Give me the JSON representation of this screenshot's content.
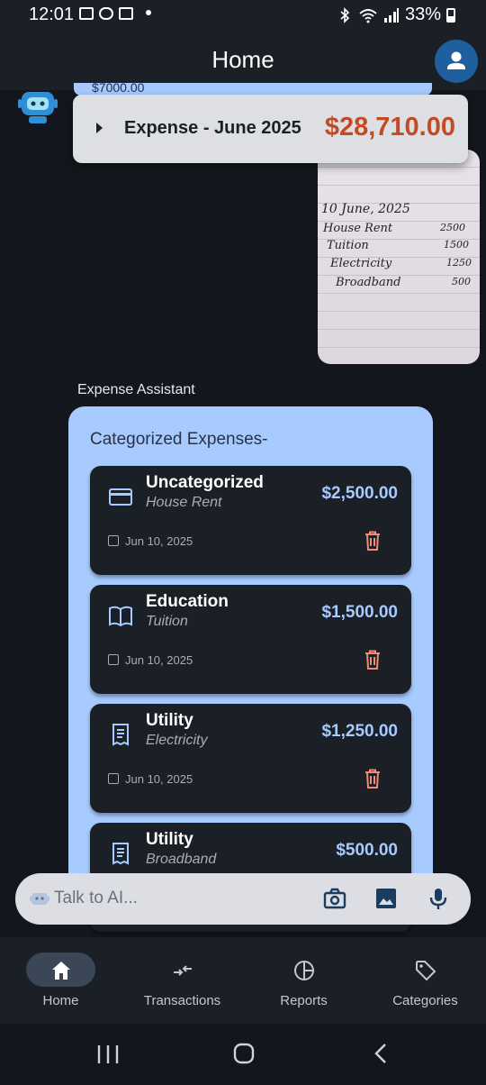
{
  "status_bar": {
    "time": "12:01",
    "battery": "33%"
  },
  "header": {
    "title": "Home"
  },
  "chat": {
    "prev_message_fragment": "$7000.00",
    "expense_banner": {
      "label": "Expense - June 2025",
      "amount": "$28,710.00"
    },
    "receipt_photo": {
      "date_line": "10 June, 2025",
      "lines": [
        {
          "item": "House Rent",
          "value": "2500"
        },
        {
          "item": "Tuition",
          "value": "1500"
        },
        {
          "item": "Electricity",
          "value": "1250"
        },
        {
          "item": "Broadband",
          "value": "500"
        }
      ]
    },
    "assistant_label": "Expense Assistant",
    "panel_heading": "Categorized Expenses-",
    "expenses": [
      {
        "category": "Uncategorized",
        "description": "House Rent",
        "amount": "$2,500.00",
        "date": "Jun 10, 2025",
        "icon": "credit-card-icon"
      },
      {
        "category": "Education",
        "description": "Tuition",
        "amount": "$1,500.00",
        "date": "Jun 10, 2025",
        "icon": "book-icon"
      },
      {
        "category": "Utility",
        "description": "Electricity",
        "amount": "$1,250.00",
        "date": "Jun 10, 2025",
        "icon": "receipt-icon"
      },
      {
        "category": "Utility",
        "description": "Broadband",
        "amount": "$500.00",
        "date": "",
        "icon": "receipt-icon"
      }
    ]
  },
  "input": {
    "placeholder": "Talk to AI..."
  },
  "bottom_nav": [
    {
      "label": "Home",
      "icon": "home-icon",
      "active": true
    },
    {
      "label": "Transactions",
      "icon": "transactions-icon",
      "active": false
    },
    {
      "label": "Reports",
      "icon": "pie-chart-icon",
      "active": false
    },
    {
      "label": "Categories",
      "icon": "tag-icon",
      "active": false
    }
  ],
  "colors": {
    "accent": "#a7cbff",
    "expense_total": "#c44a26",
    "delete": "#f28b75",
    "background": "#13161c"
  }
}
